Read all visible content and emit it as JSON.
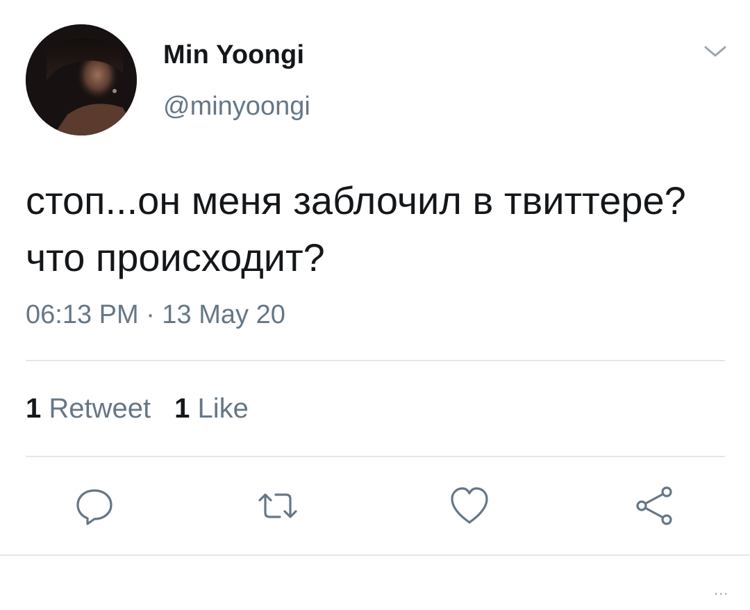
{
  "user": {
    "display_name": "Min Yoongi",
    "handle": "@minyoongi"
  },
  "tweet": {
    "text": "стоп...он меня заблочил в твиттере? что происходит?",
    "timestamp": "06:13 PM · 13 May 20"
  },
  "stats": {
    "retweets_count": "1",
    "retweets_label": "Retweet",
    "likes_count": "1",
    "likes_label": "Like"
  },
  "actions": {
    "reply_icon": "speech-bubble",
    "retweet_icon": "retweet-arrows",
    "like_icon": "heart",
    "share_icon": "share-nodes"
  },
  "footer": {
    "more": "..."
  },
  "colors": {
    "text_primary": "#14171a",
    "text_secondary": "#657786",
    "divider": "#e1e8ed"
  }
}
